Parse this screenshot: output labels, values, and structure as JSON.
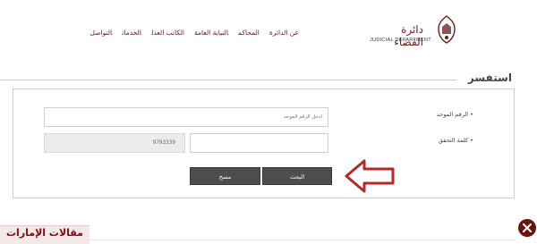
{
  "nav": {
    "items": [
      "عن الدائرة",
      "المحاكم",
      "النيابة العامة",
      "الكاتب العدل",
      "الخدمات",
      "التواصل"
    ]
  },
  "logo": {
    "arabic": "دائرة القضاء",
    "english": "JUDICIAL DEPARTMENT"
  },
  "section": {
    "title": "استفسر"
  },
  "form": {
    "unified_number_label": "• الرقم الموحد",
    "unified_number_placeholder": "أدخل الرقم الموحد",
    "captcha_label": "• كلمة التحقق",
    "captcha_code": "9793339",
    "search_button": "البحث",
    "clear_button": "مسح"
  },
  "brand": {
    "text": "مقالات الإمارات"
  },
  "colors": {
    "accent": "#5a1a1a",
    "button": "#4d4d4d",
    "arrow": "#b22a2a",
    "brand": "#7a0c0c"
  }
}
